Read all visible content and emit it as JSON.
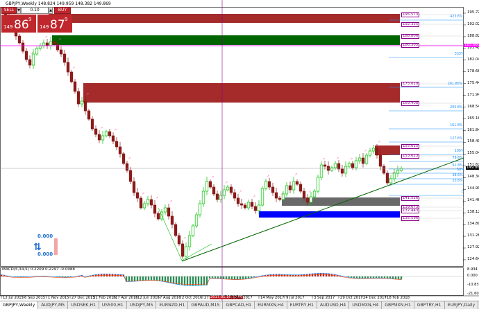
{
  "chart_title": "GBPJPY,Weekly  148.824 149.959 148.382 149.869",
  "trade_panel": {
    "sell_label": "SELL",
    "buy_label": "BUY",
    "lot": "0.10",
    "sell_price_small": "149",
    "sell_price_big": "86",
    "sell_price_sup": "9",
    "buy_price_small": "149",
    "buy_price_big": "87",
    "buy_price_sup": "9"
  },
  "price_axis": [
    "195.720",
    "192.020",
    "188.820",
    "185.420",
    "182.040",
    "178.660",
    "175.440",
    "171.940",
    "168.540",
    "165.160",
    "161.840",
    "158.400",
    "155.040",
    "151.620",
    "148.340",
    "144.900",
    "141.460",
    "138.120",
    "134.800",
    "131.280",
    "127.920",
    "124.640"
  ],
  "price_label": "149.869",
  "macd_axis": [
    "8.934",
    "0.000",
    "-10.839",
    "-21.605"
  ],
  "macd_label": "MACD(5,34,5) 0.2209 0.2297 -0.0088",
  "date_axis": [
    "12 Jul 2015",
    "6 Sep 2015",
    "1 Nov 2015",
    "27 Dec 2015",
    "21 Feb 2016",
    "17 Apr 2016",
    "12 Jun 2016",
    "7 Aug 2016",
    "2 Oct 2016",
    "27",
    "19 Mar 2017",
    "14 May 2017",
    "9 Jul 2017",
    "3 Sep 2017",
    "29 Oct 2017",
    "24 Dec 2017",
    "18 Feb 2018"
  ],
  "crosshair_label": "2017.01.16 13:00",
  "zones": [
    {
      "price_label": "195.573",
      "color": "#a52a2a"
    },
    {
      "price_label": "192.335",
      "color": "#a52a2a"
    },
    {
      "price_label": "188.806",
      "color": "#006400"
    },
    {
      "price_label": "186.305",
      "color": "#006400"
    },
    {
      "price_label": "175.010",
      "color": "#a52a2a"
    },
    {
      "price_label": "169.408",
      "color": "#a52a2a"
    },
    {
      "price_label": "155.615",
      "color": "#a52a2a"
    },
    {
      "price_label": "153.623",
      "color": "#a52a2a"
    },
    {
      "price_label": "141.526",
      "color": "#696969"
    },
    {
      "price_label": "139.673",
      "color": "#696969"
    },
    {
      "price_label": "137.443",
      "color": "#0000ff"
    },
    {
      "price_label": "135.596",
      "color": "#0000ff"
    }
  ],
  "hline_label": "185.660",
  "fib_levels": [
    "423.6%",
    "333%",
    "261.80%",
    "205.8%",
    "161.8%",
    "127.6%",
    "100%",
    "78.6%",
    "61.8%",
    "50%",
    "38.6%",
    "23.6%",
    "0"
  ],
  "widget": {
    "top_value": "0.000",
    "bottom_value": "0.000"
  },
  "tabs": [
    "GBPJPY,Weekly",
    "AUDJPY,M5",
    "USDSEK,H1",
    "US500,H1",
    "USDJPY,M5",
    "EURNZD,H1",
    "GBPAUD,M15",
    "GBPCAD,H1",
    "EURMXN,H4",
    "EURTRY,H1",
    "AUDUSD,H4",
    "USDMXN,H4",
    "GBPMXN,H1",
    "GBPTRY,H1",
    "EURJPY,Daily",
    "AUI"
  ],
  "colors": {
    "bull": "#00c000",
    "bear": "#8b1a1a",
    "trend": "#006400",
    "fib": "#1e90ff",
    "hline": "#ff00ff",
    "crosshair": "#8b008b"
  }
}
